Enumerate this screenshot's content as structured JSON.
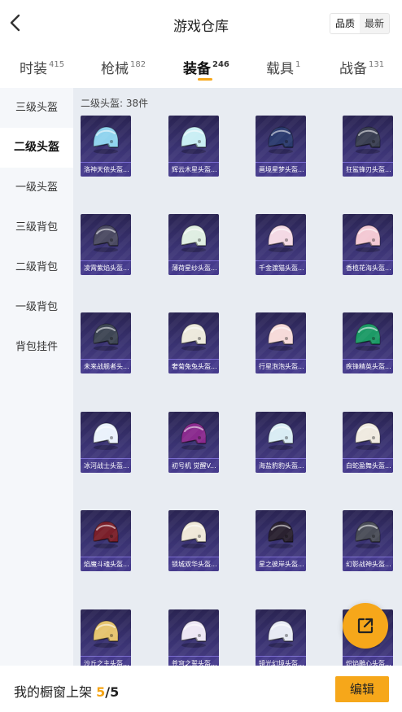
{
  "header": {
    "title": "游戏仓库",
    "sort_options": [
      "品质",
      "最新"
    ],
    "active_sort": 0
  },
  "tabs": [
    {
      "label": "时装",
      "count": "415"
    },
    {
      "label": "枪械",
      "count": "182"
    },
    {
      "label": "装备",
      "count": "246"
    },
    {
      "label": "载具",
      "count": "1"
    },
    {
      "label": "战备",
      "count": "131"
    }
  ],
  "active_tab": 2,
  "sidebar": {
    "items": [
      "三级头盔",
      "二级头盔",
      "一级头盔",
      "三级背包",
      "二级背包",
      "一级背包",
      "背包挂件"
    ],
    "active_index": 1
  },
  "section": {
    "title": "二级头盔: 38件"
  },
  "items": [
    {
      "name": "洛神天依头盔...",
      "color": "#8fd3ee",
      "icon": "helmet-icon"
    },
    {
      "name": "辉云木星头盔...",
      "color": "#c9eef4",
      "icon": "helmet-icon"
    },
    {
      "name": "画境星梦头盔...",
      "color": "#2b3a6e",
      "icon": "helmet-icon"
    },
    {
      "name": "狂鲨锋刃头盔...",
      "color": "#3a3f52",
      "icon": "helmet-icon"
    },
    {
      "name": "凌霄紫焰头盔...",
      "color": "#4b4a62",
      "icon": "helmet-icon"
    },
    {
      "name": "薄荷星纱头盔...",
      "color": "#dfeee2",
      "icon": "helmet-icon"
    },
    {
      "name": "千金渡猫头盔...",
      "color": "#f4d9e4",
      "icon": "helmet-icon"
    },
    {
      "name": "香榄花海头盔...",
      "color": "#f3c8d3",
      "icon": "helmet-icon"
    },
    {
      "name": "未来战舰者头...",
      "color": "#3e4654",
      "icon": "helmet-icon"
    },
    {
      "name": "奢菊兔兔头盔...",
      "color": "#ece9dc",
      "icon": "helmet-icon"
    },
    {
      "name": "行星泡泡头盔...",
      "color": "#f6dad9",
      "icon": "helmet-icon"
    },
    {
      "name": "疾锋精英头盔...",
      "color": "#1c9a66",
      "icon": "helmet-icon"
    },
    {
      "name": "冰河战士头盔...",
      "color": "#eaf2fb",
      "icon": "helmet-icon"
    },
    {
      "name": "初号机 觉醒V...",
      "color": "#8a2a8e",
      "icon": "helmet-icon"
    },
    {
      "name": "海盐豹豹头盔...",
      "color": "#d9ecf4",
      "icon": "helmet-icon"
    },
    {
      "name": "白蛇盈舞头盔...",
      "color": "#efeae0",
      "icon": "helmet-icon"
    },
    {
      "name": "焰魔斗魂头盔...",
      "color": "#7a1f2a",
      "icon": "helmet-icon"
    },
    {
      "name": "锁城双华头盔...",
      "color": "#efe8d8",
      "icon": "helmet-icon"
    },
    {
      "name": "星之彼岸头盔...",
      "color": "#2a2130",
      "icon": "helmet-icon"
    },
    {
      "name": "幻影战神头盔...",
      "color": "#4a4d58",
      "icon": "helmet-icon"
    },
    {
      "name": "沙丘之主头盔...",
      "color": "#e6c46e",
      "icon": "helmet-icon"
    },
    {
      "name": "苍穹之誓头盔...",
      "color": "#ece6f4",
      "icon": "helmet-icon"
    },
    {
      "name": "镜光幻境头盔...",
      "color": "#e7eaf4",
      "icon": "helmet-icon"
    },
    {
      "name": "炽焰雕心头盔...",
      "color": "#e9e2ee",
      "icon": "helmet-icon"
    }
  ],
  "footer": {
    "label": "我的橱窗上架",
    "shown": "5",
    "total": "/5",
    "edit_label": "编辑"
  },
  "icons": {
    "back": "chevron-left-icon",
    "share": "share-icon"
  },
  "colors": {
    "accent": "#f6a71a",
    "card_bg": "#3a3373"
  }
}
